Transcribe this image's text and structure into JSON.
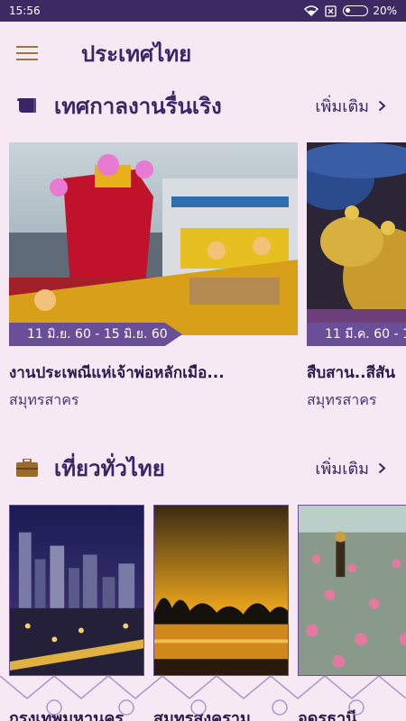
{
  "status": {
    "time": "15:56",
    "battery": "20%",
    "battery_level": 0.2
  },
  "app": {
    "title": "ประเทศไทย"
  },
  "festival_section": {
    "title": "เทศกาลงานรื่นเริง",
    "more": "เพิ่มเติม",
    "cards": [
      {
        "date": "11 มิ.ย. 60 - 15 มิ.ย. 60",
        "title": "งานประเพณีแห่เจ้าพ่อหลักเมือ...",
        "place": "สมุทรสาคร"
      },
      {
        "date": "11 มี.ค. 60 - 1",
        "title": "สืบสาน..สีสัน",
        "place": "สมุทรสาคร"
      }
    ]
  },
  "travel_section": {
    "title": "เที่ยวทั่วไทย",
    "more": "เพิ่มเติม",
    "places": [
      {
        "name": "กรุงเทพมหานคร"
      },
      {
        "name": "สมุทรสงคราม"
      },
      {
        "name": "อุดรธานี"
      }
    ]
  },
  "colors": {
    "primary": "#3b2566",
    "accent": "#6a4e98",
    "background": "#f7e9f4",
    "statusbar": "#3d2a63"
  }
}
